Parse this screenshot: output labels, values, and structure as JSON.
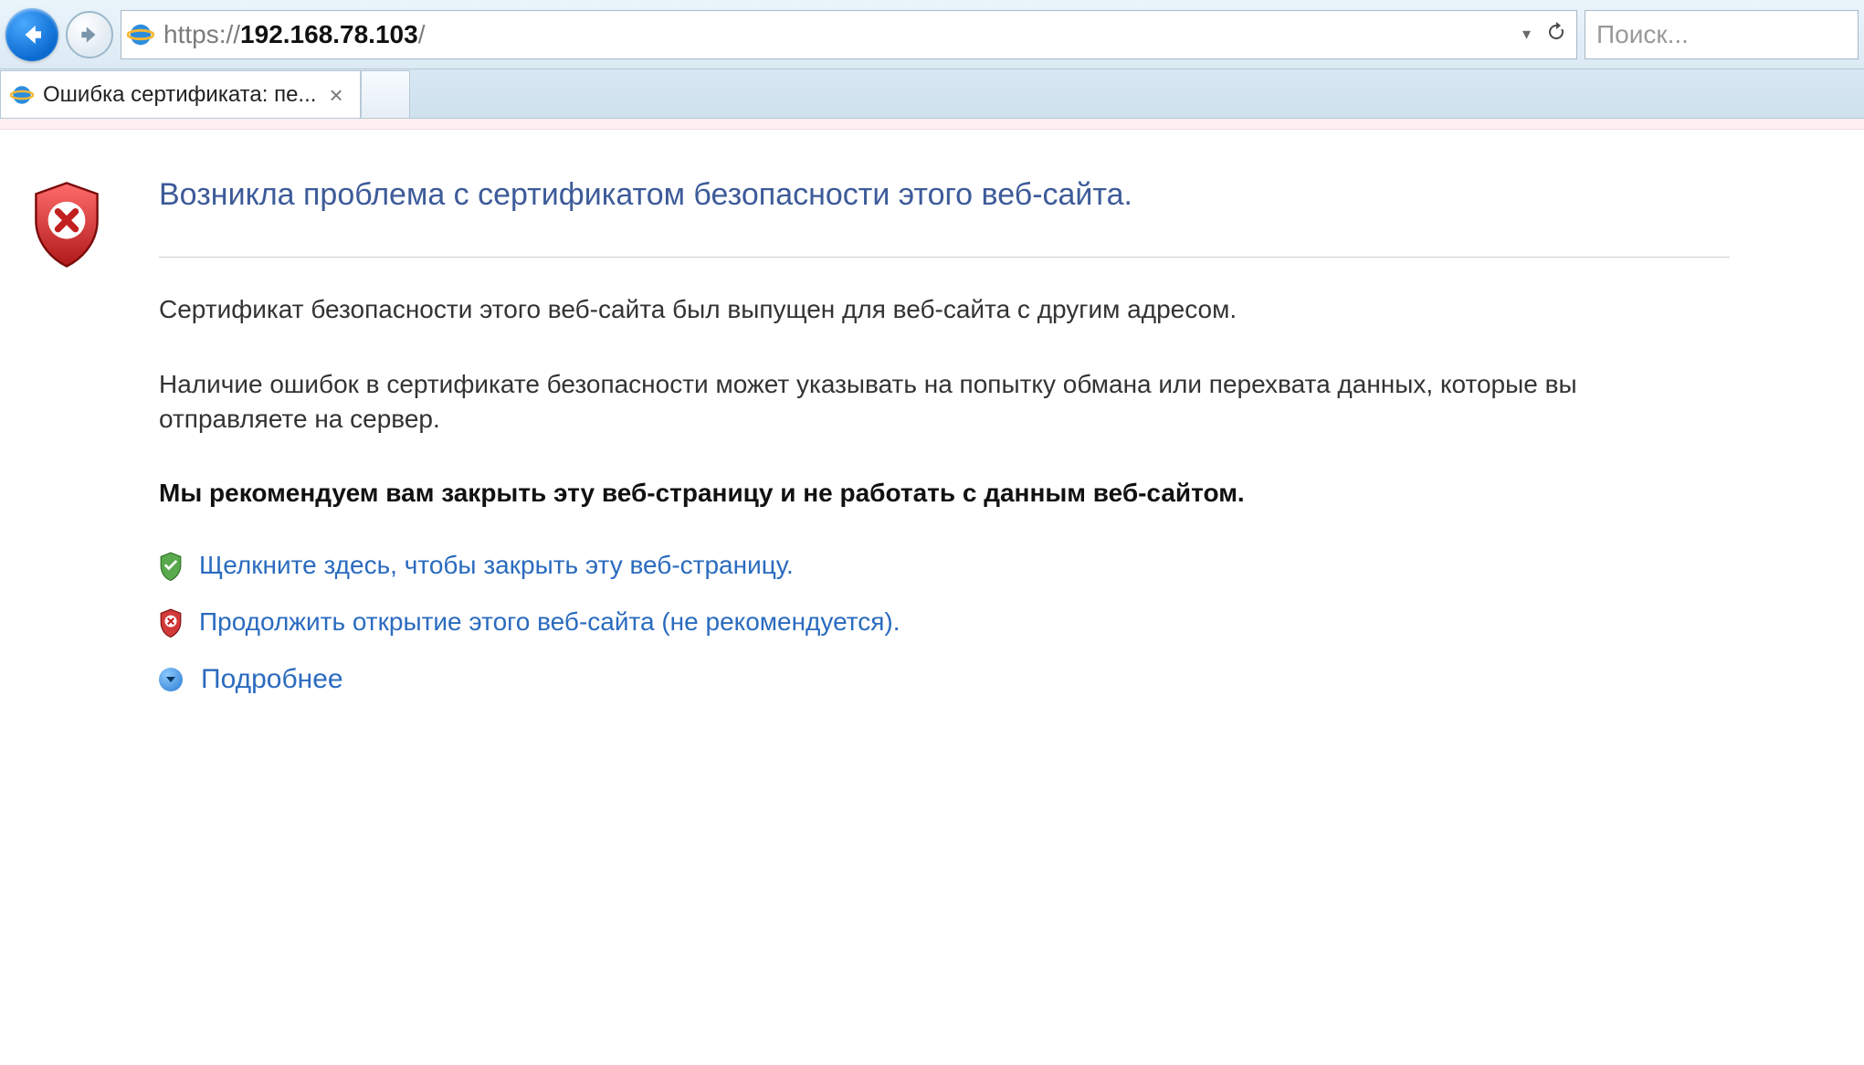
{
  "addressbar": {
    "scheme": "https://",
    "host": "192.168.78.103",
    "path": "/"
  },
  "searchbox": {
    "placeholder": "Поиск..."
  },
  "tab": {
    "title": "Ошибка сертификата: пе..."
  },
  "page": {
    "heading": "Возникла проблема с сертификатом безопасности этого веб-сайта.",
    "para1": "Сертификат безопасности этого веб-сайта был выпущен для веб-сайта с другим адресом.",
    "para2": "Наличие ошибок в сертификате безопасности может указывать на попытку обмана или перехвата данных, которые вы отправляете на сервер.",
    "recommend": "Мы рекомендуем вам закрыть эту веб-страницу и не работать с данным веб-сайтом.",
    "close_link": "Щелкните здесь, чтобы закрыть эту веб-страницу.",
    "continue_link": "Продолжить открытие этого веб-сайта (не рекомендуется).",
    "more": "Подробнее"
  }
}
